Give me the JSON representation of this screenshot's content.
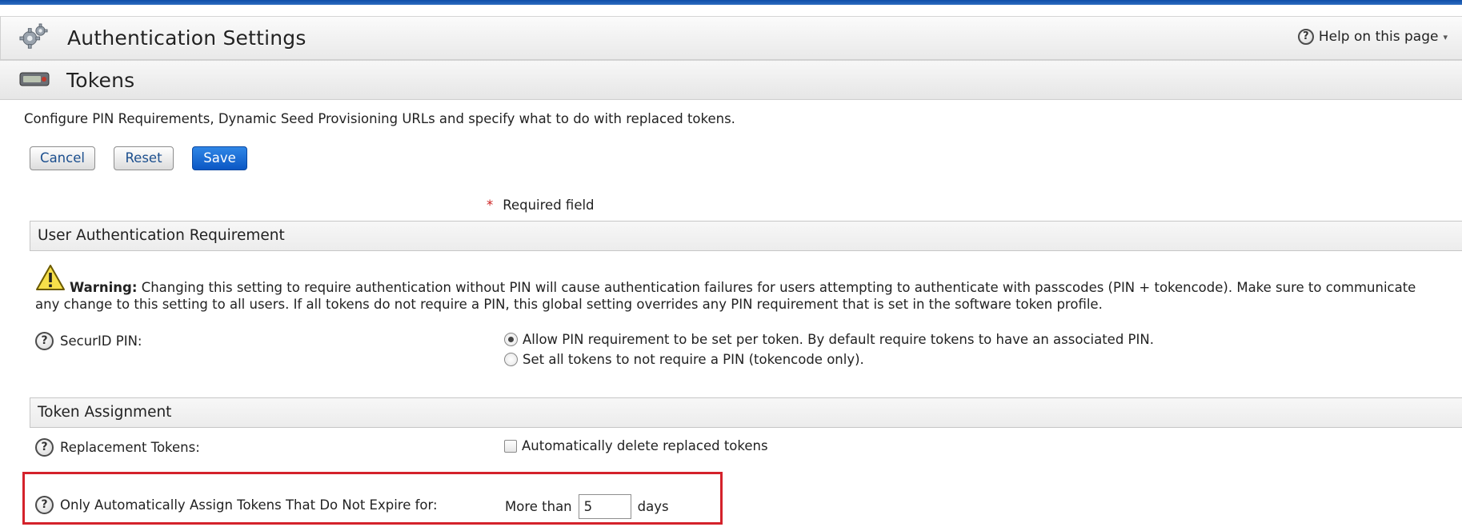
{
  "header": {
    "title": "Authentication Settings",
    "help_label": "Help on this page",
    "help_caret": "▾"
  },
  "subheader": {
    "title": "Tokens"
  },
  "description": "Configure PIN Requirements, Dynamic Seed Provisioning URLs and specify what to do with replaced tokens.",
  "buttons": {
    "cancel": "Cancel",
    "reset": "Reset",
    "save": "Save"
  },
  "required": {
    "star": "*",
    "label": "Required field"
  },
  "sections": {
    "user_auth": {
      "title": "User Authentication Requirement",
      "warning_bold": "Warning:",
      "warning_text": " Changing this setting to require authentication without PIN will cause authentication failures for users attempting to authenticate with passcodes (PIN + tokencode). Make sure to communicate any change to this setting to all users. If all tokens do not require a PIN, this global setting overrides any PIN requirement that is set in the software token profile.",
      "securid_label": "SecurID PIN:",
      "options": [
        {
          "label": "Allow PIN requirement to be set per token. By default require tokens to have an associated PIN.",
          "selected": true
        },
        {
          "label": "Set all tokens to not require a PIN (tokencode only).",
          "selected": false
        }
      ]
    },
    "token_assignment": {
      "title": "Token Assignment",
      "replacement_label": "Replacement Tokens:",
      "replacement_option": "Automatically delete replaced tokens",
      "replacement_checked": false,
      "expire_label": "Only Automatically Assign Tokens That Do Not Expire for:",
      "more_than": "More than",
      "days_value": "5",
      "days_unit": "days"
    }
  },
  "colors": {
    "accent_blue": "#0b57c4",
    "highlight_red": "#d4222b"
  },
  "icons": {
    "help": "question-circle-icon",
    "gear": "gears-icon",
    "token": "hardware-token-icon",
    "warning": "warning-triangle-icon"
  }
}
